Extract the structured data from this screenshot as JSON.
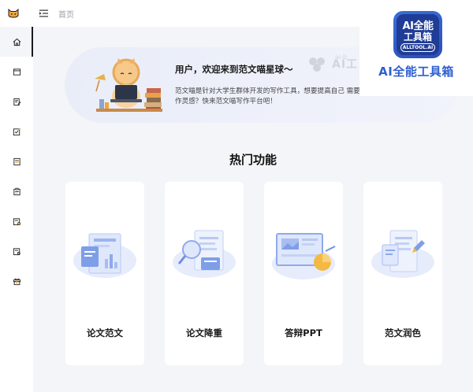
{
  "header": {
    "logo_icon": "cat-logo-icon",
    "menu_icon": "menu-fold-icon",
    "breadcrumb": "首页"
  },
  "sidebar": {
    "items": [
      {
        "icon": "home-icon",
        "active": true
      },
      {
        "icon": "browser-window-icon",
        "active": false
      },
      {
        "icon": "document-edit-icon",
        "active": false
      },
      {
        "icon": "checklist-icon",
        "active": false
      },
      {
        "icon": "document-list-icon",
        "active": false
      },
      {
        "icon": "clipboard-icon",
        "active": false
      },
      {
        "icon": "file-gear-icon",
        "active": false
      },
      {
        "icon": "file-search-icon",
        "active": false
      },
      {
        "icon": "gift-icon",
        "active": false
      }
    ]
  },
  "banner": {
    "title": "用户，欢迎来到范文喵星球～",
    "description": "范文喵是针对大学生群体开发的写作工具，想要提高自己 需要写作灵感？快来范文喵写作平台吧！",
    "watermark": "AI工",
    "watermark_small": "ai-b"
  },
  "section": {
    "title": "热门功能"
  },
  "cards": [
    {
      "label": "论文范文",
      "icon": "paper-sample-illustration"
    },
    {
      "label": "论文降重",
      "icon": "paper-rewrite-illustration"
    },
    {
      "label": "答辩PPT",
      "icon": "presentation-illustration"
    },
    {
      "label": "范文润色",
      "icon": "polish-illustration"
    }
  ],
  "ai_badge": {
    "logo_line1": "AI全能",
    "logo_line2": "工具箱",
    "logo_line3": "ALLTOOL.AI",
    "caption": "AI全能工具箱"
  },
  "colors": {
    "accent_blue": "#2f5fd0",
    "sidebar_active_bar": "#1a1a1a",
    "banner_bg": "#e9edf8",
    "page_bg": "#f4f5f8"
  }
}
